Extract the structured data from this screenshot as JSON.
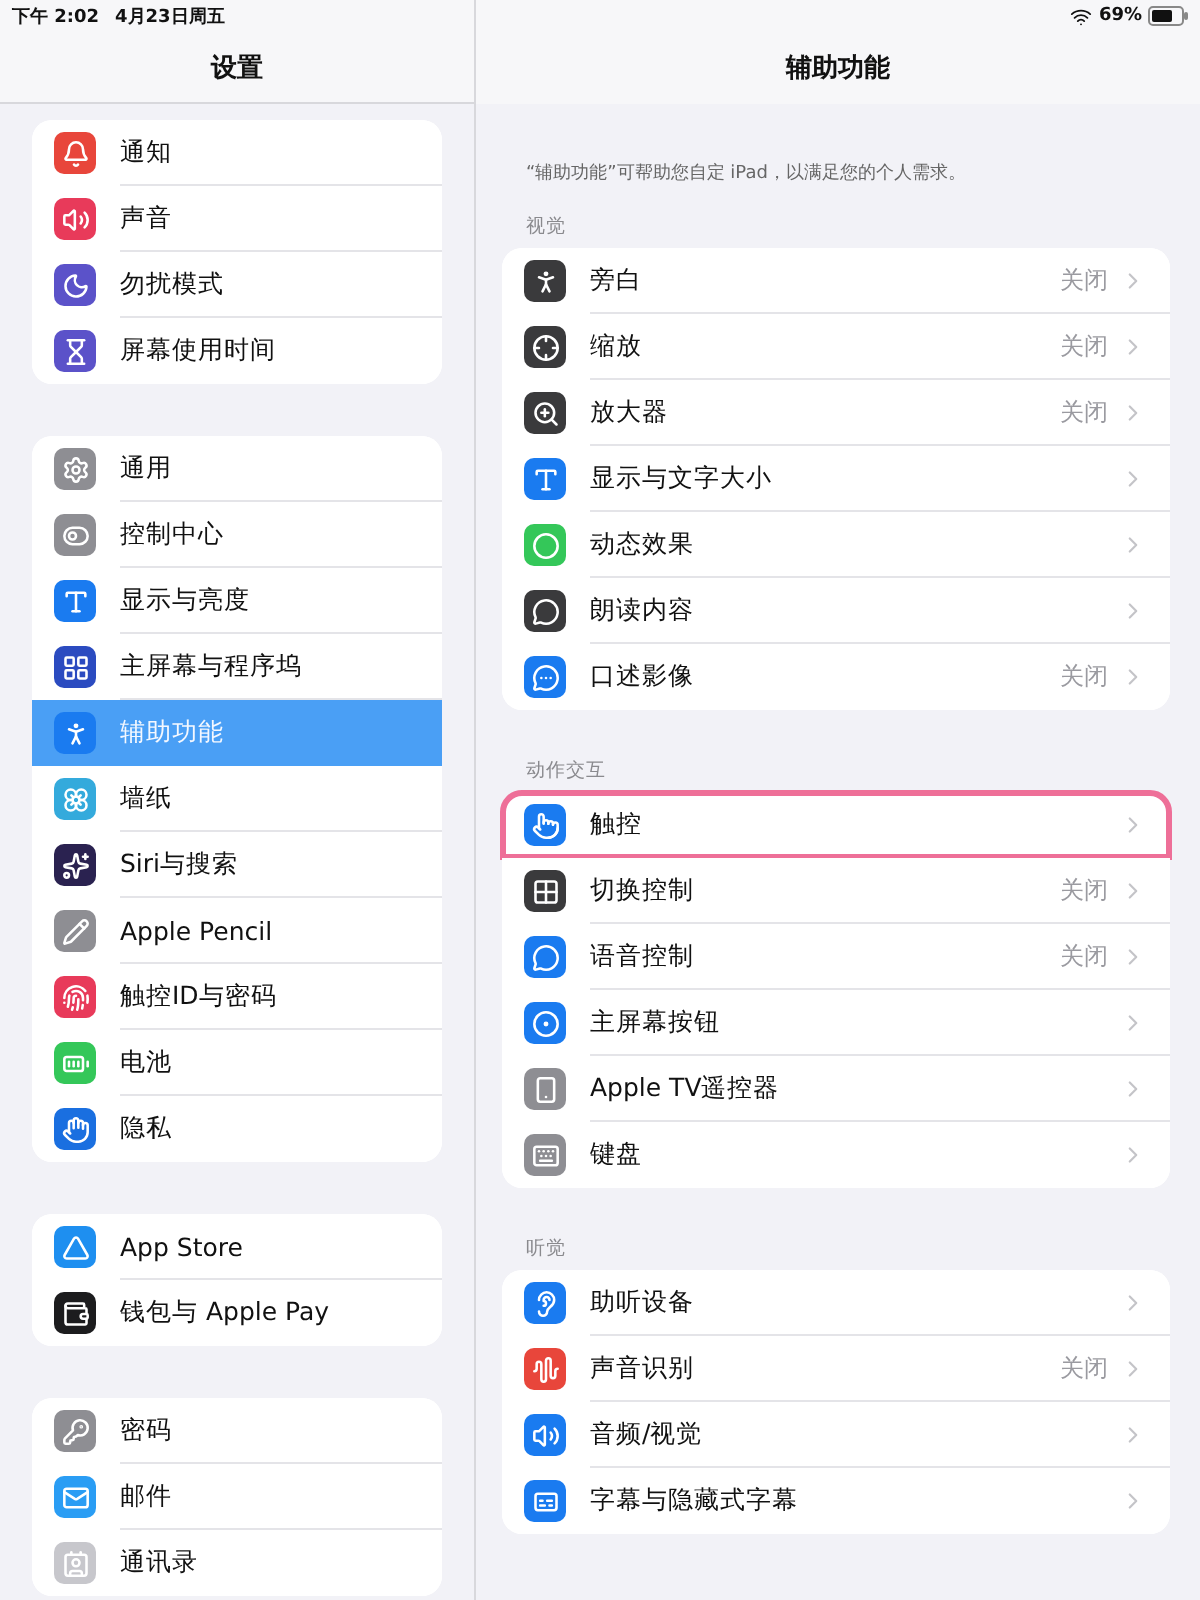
{
  "status_bar": {
    "time": "下午 2:02",
    "date": "4月23日周五",
    "battery": "69%"
  },
  "sidebar": {
    "title": "设置",
    "groups": [
      {
        "items": [
          {
            "label": "通知",
            "selected": false
          },
          {
            "label": "声音",
            "selected": false
          },
          {
            "label": "勿扰模式",
            "selected": false
          },
          {
            "label": "屏幕使用时间",
            "selected": false
          }
        ]
      },
      {
        "items": [
          {
            "label": "通用",
            "selected": false
          },
          {
            "label": "控制中心",
            "selected": false
          },
          {
            "label": "显示与亮度",
            "selected": false
          },
          {
            "label": "主屏幕与程序坞",
            "selected": false
          },
          {
            "label": "辅助功能",
            "selected": true
          },
          {
            "label": "墙纸",
            "selected": false
          },
          {
            "label": "Siri与搜索",
            "selected": false
          },
          {
            "label": "Apple Pencil",
            "selected": false
          },
          {
            "label": "触控ID与密码",
            "selected": false
          },
          {
            "label": "电池",
            "selected": false
          },
          {
            "label": "隐私",
            "selected": false
          }
        ]
      },
      {
        "items": [
          {
            "label": "App Store",
            "selected": false
          },
          {
            "label": "钱包与 Apple Pay",
            "selected": false
          }
        ]
      },
      {
        "items": [
          {
            "label": "密码",
            "selected": false
          },
          {
            "label": "邮件",
            "selected": false
          },
          {
            "label": "通讯录",
            "selected": false
          }
        ]
      }
    ]
  },
  "detail": {
    "title": "辅助功能",
    "description": "“辅助功能”可帮助您自定 iPad，以满足您的个人需求。",
    "sections": [
      {
        "header": "视觉",
        "items": [
          {
            "label": "旁白",
            "value": "关闭",
            "highlighted": false
          },
          {
            "label": "缩放",
            "value": "关闭",
            "highlighted": false
          },
          {
            "label": "放大器",
            "value": "关闭",
            "highlighted": false
          },
          {
            "label": "显示与文字大小",
            "highlighted": false
          },
          {
            "label": "动态效果",
            "highlighted": false
          },
          {
            "label": "朗读内容",
            "highlighted": false
          },
          {
            "label": "口述影像",
            "value": "关闭",
            "highlighted": false
          }
        ]
      },
      {
        "header": "动作交互",
        "items": [
          {
            "label": "触控",
            "highlighted": true
          },
          {
            "label": "切换控制",
            "value": "关闭",
            "highlighted": false
          },
          {
            "label": "语音控制",
            "value": "关闭",
            "highlighted": false
          },
          {
            "label": "主屏幕按钮",
            "highlighted": false
          },
          {
            "label": "Apple TV遥控器",
            "highlighted": false
          },
          {
            "label": "键盘",
            "highlighted": false
          }
        ]
      },
      {
        "header": "听觉",
        "items": [
          {
            "label": "助听设备",
            "highlighted": false
          },
          {
            "label": "声音识别",
            "value": "关闭",
            "highlighted": false
          },
          {
            "label": "音频/视觉",
            "highlighted": false
          },
          {
            "label": "字幕与隐藏式字幕",
            "highlighted": false
          }
        ]
      }
    ]
  }
}
